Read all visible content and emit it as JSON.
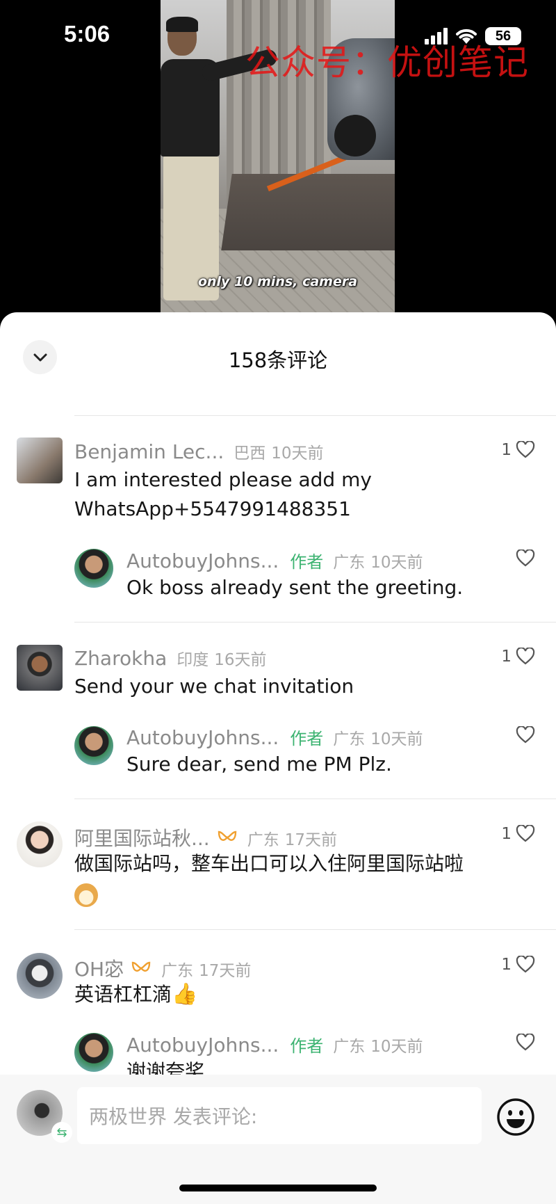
{
  "status_bar": {
    "time": "5:06",
    "battery": "56"
  },
  "video": {
    "subtitle": "only 10 mins, camera",
    "watermark": "公众号：优创笔记"
  },
  "sheet": {
    "title": "158条评论"
  },
  "comments": [
    {
      "user": "Benjamin Lec...",
      "location": "巴西",
      "time": "10天前",
      "text_line1": "I am interested please add my",
      "text_line2": "WhatsApp+5547991488351",
      "likes": "1",
      "reply": {
        "user": "AutobuyJohns...",
        "tag": "作者",
        "location": "广东",
        "time": "10天前",
        "text": "Ok boss already sent the greeting."
      }
    },
    {
      "user": "Zharokha",
      "location": "印度",
      "time": "16天前",
      "text": "Send your we chat invitation",
      "likes": "1",
      "reply": {
        "user": "AutobuyJohns...",
        "tag": "作者",
        "location": "广东",
        "time": "10天前",
        "text": "Sure dear, send me PM Plz."
      }
    },
    {
      "user": "阿里国际站秋...",
      "location": "广东",
      "time": "17天前",
      "text": "做国际站吗，整车出口可以入住阿里国际站啦",
      "likes": "1"
    },
    {
      "user": "OH宓",
      "location": "广东",
      "time": "17天前",
      "text": "英语杠杠滴",
      "likes": "1",
      "reply": {
        "user": "AutobuyJohns...",
        "tag": "作者",
        "location": "广东",
        "time": "10天前",
        "text": "谢谢夸奖"
      }
    }
  ],
  "input": {
    "placeholder": "两极世界 发表评论:"
  },
  "colors": {
    "author_tag": "#3cb371",
    "badge": "#f0a030",
    "watermark": "#e61414"
  }
}
